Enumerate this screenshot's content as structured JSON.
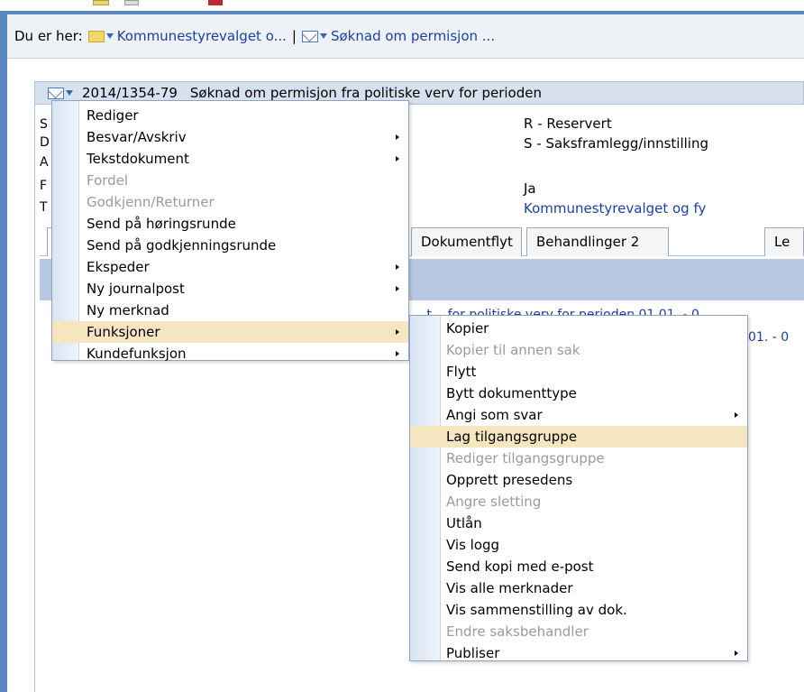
{
  "breadcrumb": {
    "label": "Du er her:",
    "item1": "Kommunestyrevalget o...",
    "separator": "|",
    "item2": "Søknad om permisjon ..."
  },
  "document": {
    "number": "2014/1354-79",
    "title": "Søknad om permisjon fra politiske verv for perioden"
  },
  "side_labels": [
    "S",
    "D",
    "A",
    "F",
    "T"
  ],
  "fields": {
    "value1": "R - Reservert",
    "value2": "S - Saksframlegg/innstilling",
    "value3": "Ja",
    "value4": "Kommunestyrevalget og fy"
  },
  "tabs": [
    {
      "label": "Dokumentflyt"
    },
    {
      "label": "Behandlinger",
      "count": "2"
    },
    {
      "label": "Le"
    }
  ],
  "list_links": [
    "...t... for politiske verv for perioden 01.01. - 0",
    "01. - 0"
  ],
  "menu_main": [
    {
      "label": "Rediger",
      "disabled": false,
      "submenu": false
    },
    {
      "label": "Besvar/Avskriv",
      "disabled": false,
      "submenu": true
    },
    {
      "label": "Tekstdokument",
      "disabled": false,
      "submenu": true
    },
    {
      "label": "Fordel",
      "disabled": true,
      "submenu": false
    },
    {
      "label": "Godkjenn/Returner",
      "disabled": true,
      "submenu": false
    },
    {
      "label": "Send på høringsrunde",
      "disabled": false,
      "submenu": false
    },
    {
      "label": "Send på godkjenningsrunde",
      "disabled": false,
      "submenu": false
    },
    {
      "label": "Ekspeder",
      "disabled": false,
      "submenu": true
    },
    {
      "label": "Ny journalpost",
      "disabled": false,
      "submenu": true
    },
    {
      "label": "Ny merknad",
      "disabled": false,
      "submenu": false
    },
    {
      "label": "Funksjoner",
      "disabled": false,
      "submenu": true,
      "highlighted": true
    },
    {
      "label": "Kundefunksjon",
      "disabled": false,
      "submenu": true
    }
  ],
  "menu_sub": [
    {
      "label": "Kopier",
      "disabled": false,
      "submenu": false
    },
    {
      "label": "Kopier til annen sak",
      "disabled": true,
      "submenu": false
    },
    {
      "label": "Flytt",
      "disabled": false,
      "submenu": false
    },
    {
      "label": "Bytt dokumenttype",
      "disabled": false,
      "submenu": false
    },
    {
      "label": "Angi som svar",
      "disabled": false,
      "submenu": true
    },
    {
      "label": "Lag tilgangsgruppe",
      "disabled": false,
      "submenu": false,
      "highlighted": true
    },
    {
      "label": "Rediger tilgangsgruppe",
      "disabled": true,
      "submenu": false
    },
    {
      "label": "Opprett presedens",
      "disabled": false,
      "submenu": false
    },
    {
      "label": "Angre sletting",
      "disabled": true,
      "submenu": false
    },
    {
      "label": "Utlån",
      "disabled": false,
      "submenu": false
    },
    {
      "label": "Vis logg",
      "disabled": false,
      "submenu": false
    },
    {
      "label": "Send kopi med e-post",
      "disabled": false,
      "submenu": false
    },
    {
      "label": "Vis alle merknader",
      "disabled": false,
      "submenu": false
    },
    {
      "label": "Vis sammenstilling av dok.",
      "disabled": false,
      "submenu": false
    },
    {
      "label": "Endre saksbehandler",
      "disabled": true,
      "submenu": false
    },
    {
      "label": "Publiser",
      "disabled": false,
      "submenu": true
    }
  ],
  "colors": {
    "frame": "#5a86bf",
    "link": "#1b3fa8",
    "highlight": "#f5e6c0",
    "disabled": "#9a9a9a"
  }
}
